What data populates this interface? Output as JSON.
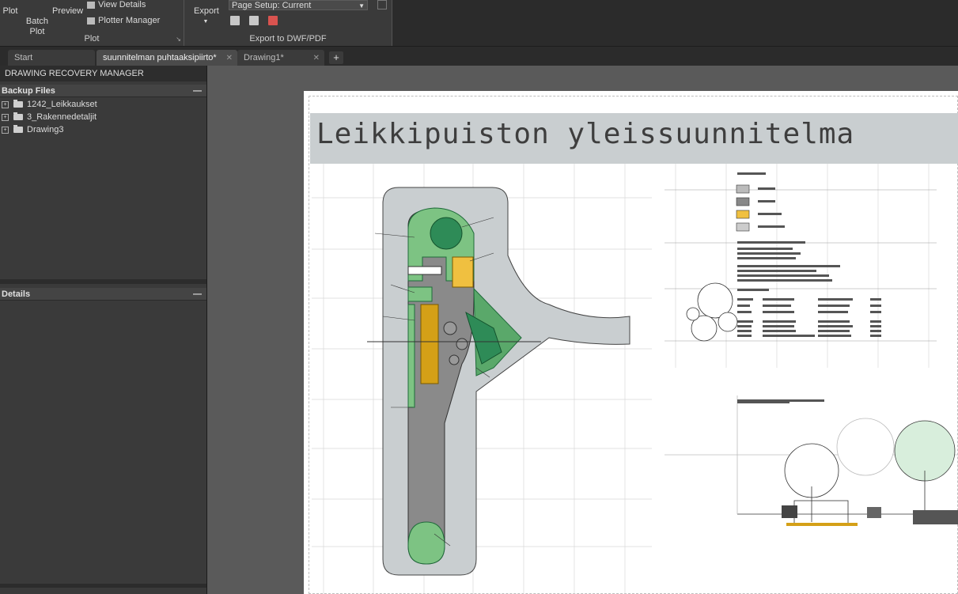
{
  "ribbon": {
    "plot_group": {
      "plot_label": "Plot",
      "batch_plot_label": "Batch\nPlot",
      "preview_label": "Preview",
      "view_details_label": "View Details",
      "plotter_manager_label": "Plotter Manager",
      "group_label": "Plot"
    },
    "export_group": {
      "export_label": "Export",
      "page_setup_value": "Page Setup: Current",
      "group_label": "Export to DWF/PDF"
    }
  },
  "tabs": [
    {
      "label": "Start",
      "active": false
    },
    {
      "label": "suunnitelman puhtaaksipiirto*",
      "active": true
    },
    {
      "label": "Drawing1*",
      "active": false
    }
  ],
  "recovery_panel": {
    "title": "DRAWING RECOVERY MANAGER",
    "backup_header": "Backup Files",
    "files": [
      "1242_Leikkaukset",
      "3_Rakennedetaljit",
      "Drawing3"
    ],
    "details_header": "Details"
  },
  "drawing": {
    "title": "Leikkipuiston yleissuunnitelma",
    "colors": {
      "path": "#c9ced0",
      "green_dark": "#2e8b57",
      "green_light": "#7dc383",
      "yellow": "#f0c040",
      "orange": "#d4a017",
      "gravel": "#8a8a8a"
    }
  }
}
